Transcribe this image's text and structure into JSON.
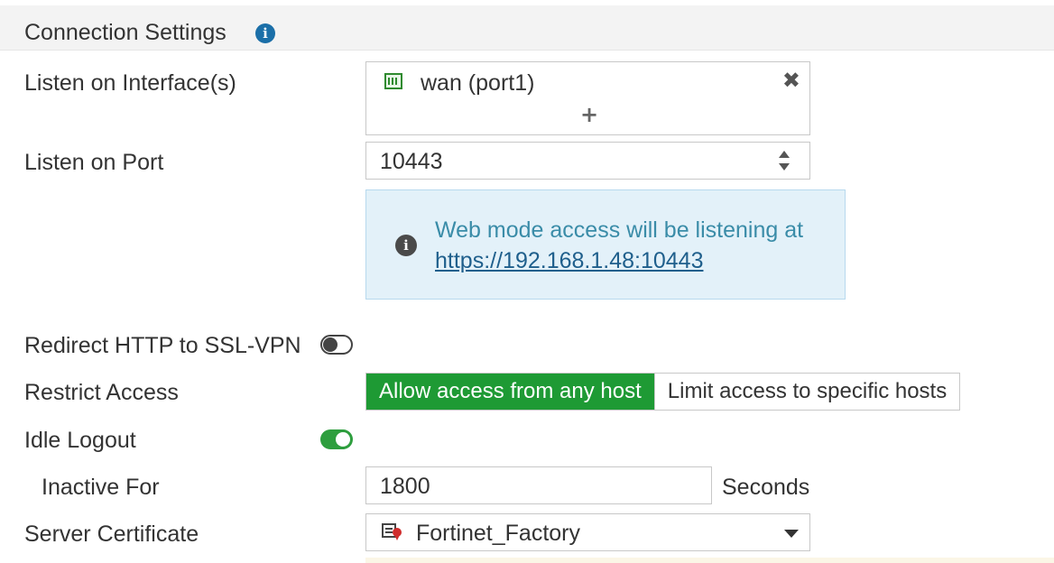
{
  "section": {
    "title": "Connection Settings",
    "info_glyph": "i"
  },
  "listen_interfaces": {
    "label": "Listen on Interface(s)",
    "selected": "wan (port1)",
    "add_glyph": "+",
    "remove_glyph": "✖",
    "icon": "network-port-icon"
  },
  "listen_port": {
    "label": "Listen on Port",
    "value": "10443"
  },
  "notice": {
    "icon": "info-icon",
    "glyph": "i",
    "text": "Web mode access will be listening at",
    "link": "https://192.168.1.48:10443"
  },
  "redirect_http": {
    "label": "Redirect HTTP to SSL-VPN",
    "enabled": false
  },
  "restrict_access": {
    "label": "Restrict Access",
    "options": [
      "Allow access from any host",
      "Limit access to specific hosts"
    ],
    "selected": "Allow access from any host"
  },
  "idle_logout": {
    "label": "Idle Logout",
    "enabled": true
  },
  "inactive_for": {
    "label": "Inactive For",
    "value": "1800",
    "unit": "Seconds"
  },
  "server_certificate": {
    "label": "Server Certificate",
    "value": "Fortinet_Factory",
    "icon": "certificate-icon"
  },
  "colors": {
    "accent_green": "#1e9a34",
    "notice_bg": "#e3f1f9",
    "info_blue": "#1b6fa8"
  }
}
